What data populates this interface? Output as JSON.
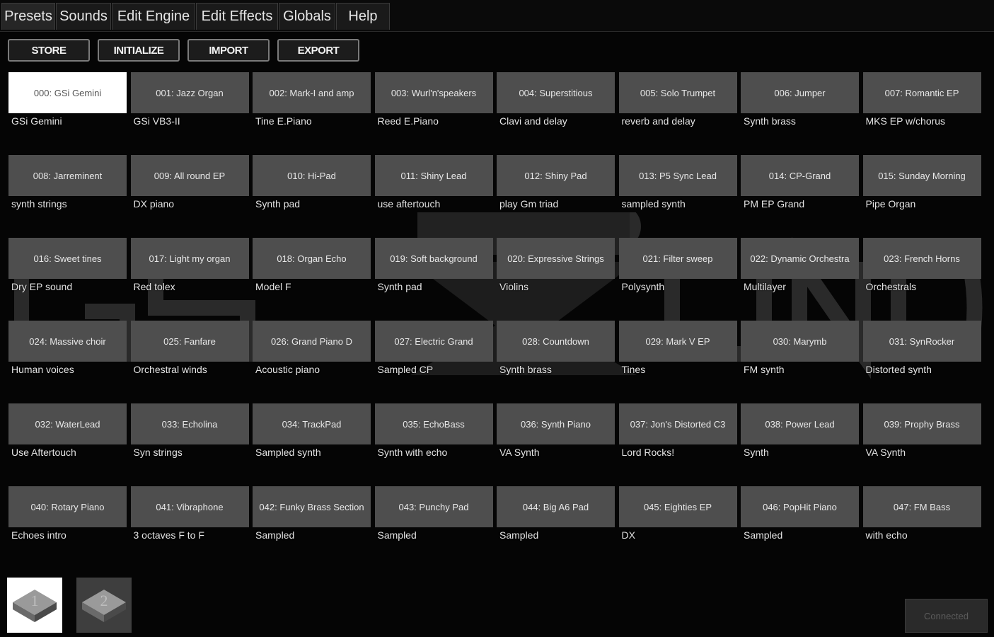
{
  "tabs": [
    {
      "label": "Presets"
    },
    {
      "label": "Sounds"
    },
    {
      "label": "Edit Engine"
    },
    {
      "label": "Edit Effects"
    },
    {
      "label": "Globals"
    },
    {
      "label": "Help"
    }
  ],
  "actions": {
    "store": "STORE",
    "initialize": "INITIALIZE",
    "import": "IMPORT",
    "export": "EXPORT"
  },
  "presets": [
    {
      "name": "000: GSi Gemini",
      "desc": "GSi Gemini",
      "selected": true
    },
    {
      "name": "001: Jazz Organ",
      "desc": "GSi VB3-II"
    },
    {
      "name": "002: Mark-I and amp",
      "desc": "Tine E.Piano"
    },
    {
      "name": "003: Wurl'n'speakers",
      "desc": "Reed E.Piano"
    },
    {
      "name": "004: Superstitious",
      "desc": "Clavi and delay"
    },
    {
      "name": "005: Solo Trumpet",
      "desc": "reverb and delay"
    },
    {
      "name": "006: Jumper",
      "desc": "Synth brass"
    },
    {
      "name": "007: Romantic EP",
      "desc": "MKS EP w/chorus"
    },
    {
      "name": "008: Jarreminent",
      "desc": "synth strings"
    },
    {
      "name": "009: All round EP",
      "desc": "DX piano"
    },
    {
      "name": "010: Hi-Pad",
      "desc": "Synth pad"
    },
    {
      "name": "011: Shiny Lead",
      "desc": "use aftertouch"
    },
    {
      "name": "012: Shiny Pad",
      "desc": "play Gm triad"
    },
    {
      "name": "013: P5 Sync Lead",
      "desc": "sampled synth"
    },
    {
      "name": "014: CP-Grand",
      "desc": "PM EP Grand"
    },
    {
      "name": "015: Sunday Morning",
      "desc": "Pipe Organ"
    },
    {
      "name": "016: Sweet tines",
      "desc": "Dry EP sound"
    },
    {
      "name": "017: Light my organ",
      "desc": "Red tolex"
    },
    {
      "name": "018: Organ Echo",
      "desc": "Model F"
    },
    {
      "name": "019: Soft background",
      "desc": "Synth pad"
    },
    {
      "name": "020: Expressive Strings",
      "desc": "Violins"
    },
    {
      "name": "021: Filter sweep",
      "desc": "Polysynth"
    },
    {
      "name": "022: Dynamic Orchestra",
      "desc": "Multilayer"
    },
    {
      "name": "023: French Horns",
      "desc": "Orchestrals"
    },
    {
      "name": "024: Massive choir",
      "desc": "Human voices"
    },
    {
      "name": "025: Fanfare",
      "desc": "Orchestral winds"
    },
    {
      "name": "026: Grand Piano D",
      "desc": "Acoustic piano"
    },
    {
      "name": "027: Electric Grand",
      "desc": "Sampled CP"
    },
    {
      "name": "028: Countdown",
      "desc": "Synth brass"
    },
    {
      "name": "029: Mark V EP",
      "desc": "Tines"
    },
    {
      "name": "030: Marymb",
      "desc": "FM synth"
    },
    {
      "name": "031: SynRocker",
      "desc": "Distorted synth"
    },
    {
      "name": "032: WaterLead",
      "desc": "Use Aftertouch"
    },
    {
      "name": "033: Echolina",
      "desc": "Syn strings"
    },
    {
      "name": "034: TrackPad",
      "desc": "Sampled synth"
    },
    {
      "name": "035: EchoBass",
      "desc": "Synth with echo"
    },
    {
      "name": "036: Synth Piano",
      "desc": "VA Synth"
    },
    {
      "name": "037: Jon's Distorted C3",
      "desc": "Lord Rocks!"
    },
    {
      "name": "038: Power Lead",
      "desc": "Synth"
    },
    {
      "name": "039: Prophy Brass",
      "desc": "VA Synth"
    },
    {
      "name": "040: Rotary Piano",
      "desc": "Echoes intro"
    },
    {
      "name": "041: Vibraphone",
      "desc": "3 octaves F to F"
    },
    {
      "name": "042: Funky Brass Section",
      "desc": "Sampled"
    },
    {
      "name": "043: Punchy Pad",
      "desc": "Sampled"
    },
    {
      "name": "044: Big A6 Pad",
      "desc": "Sampled"
    },
    {
      "name": "045: Eighties EP",
      "desc": "DX"
    },
    {
      "name": "046: PopHit Piano",
      "desc": "Sampled"
    },
    {
      "name": "047: FM Bass",
      "desc": "with echo"
    }
  ],
  "banks": [
    {
      "label": "1",
      "selected": true
    },
    {
      "label": "2",
      "selected": false
    }
  ],
  "status": {
    "connected": "Connected"
  },
  "colors": {
    "background": "#050505",
    "preset_button": "#4e4e4e",
    "selected_preset": "#ffffff"
  }
}
